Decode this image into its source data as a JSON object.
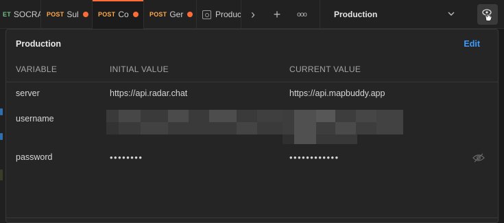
{
  "tabs": [
    {
      "method": "ET",
      "method_color": "#73c08a",
      "name": "SOCRA",
      "modified": false,
      "active": false
    },
    {
      "method": "POST",
      "method_color": "#ffa94d",
      "name": "Sul",
      "modified": true,
      "active": false
    },
    {
      "method": "POST",
      "method_color": "#ffa94d",
      "name": "Co",
      "modified": true,
      "active": true
    },
    {
      "method": "POST",
      "method_color": "#ffa94d",
      "name": "Ger",
      "modified": true,
      "active": false
    }
  ],
  "env_tab": {
    "label": "Produc",
    "icon": "environment-icon"
  },
  "tab_actions": {
    "more_glyph": "›",
    "add_glyph": "+",
    "options_glyph": "ooo"
  },
  "env_selector": {
    "selected": "Production",
    "icon": "chevron-down-icon"
  },
  "quicklook_button": {
    "icon": "eye-hand-icon"
  },
  "panel": {
    "title": "Production",
    "edit_label": "Edit",
    "columns": {
      "variable": "VARIABLE",
      "initial": "INITIAL VALUE",
      "current": "CURRENT VALUE"
    },
    "rows": [
      {
        "variable": "server",
        "initial": "https://api.radar.chat",
        "current": "https://api.mapbuddy.app"
      },
      {
        "variable": "username",
        "initial": "",
        "current": ""
      },
      {
        "variable": "password",
        "initial": "••••••••",
        "current": "••••••••••••"
      }
    ]
  },
  "colors": {
    "accent": "#ff6c37",
    "link": "#3f9bff",
    "unsaved_dot": "#ff6c37"
  }
}
